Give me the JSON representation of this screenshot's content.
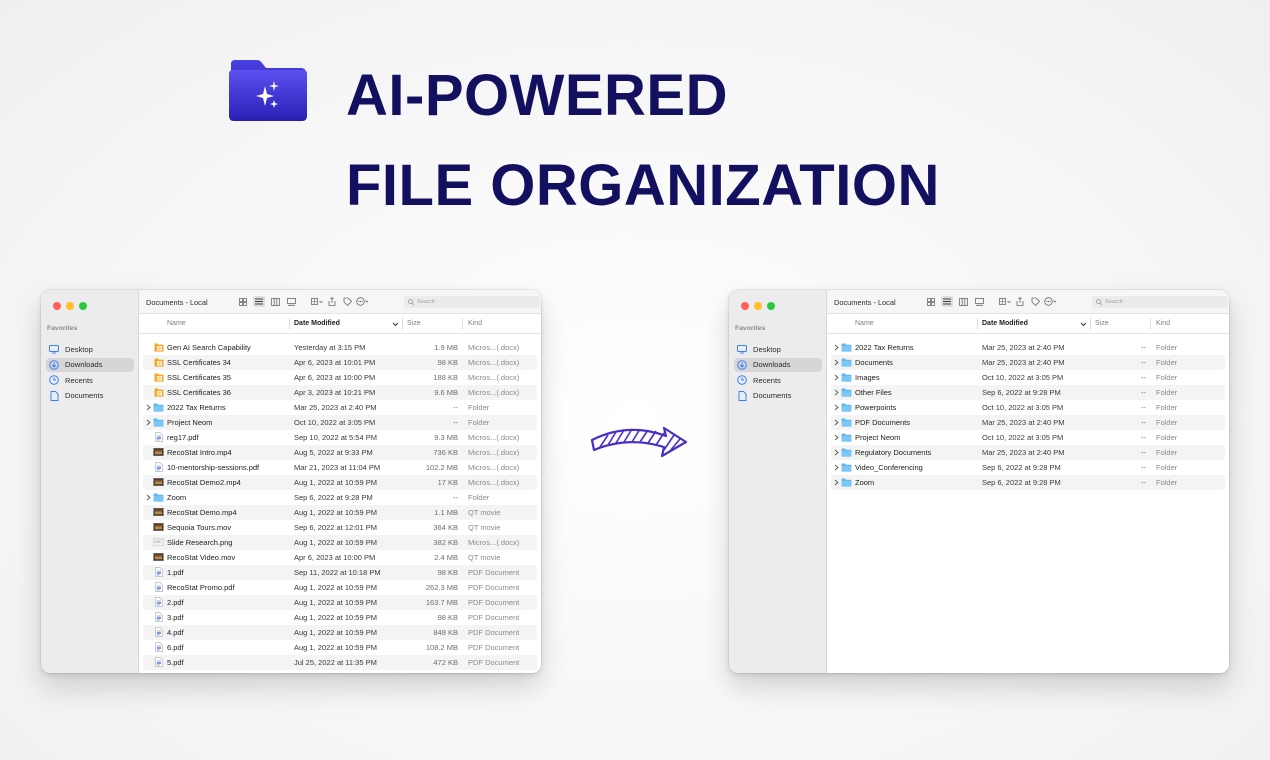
{
  "hero": {
    "line1": "AI-POWERED",
    "line2": "FILE ORGANIZATION",
    "accent_color": "#13105f",
    "icon": "folder-sparkle-icon"
  },
  "left_window": {
    "path_title": "Documents - Local",
    "search_placeholder": "Search",
    "sidebar": {
      "section": "Favorites",
      "items": [
        {
          "label": "Desktop",
          "icon": "desktop-icon",
          "selected": false
        },
        {
          "label": "Downloads",
          "icon": "download-icon",
          "selected": true
        },
        {
          "label": "Recents",
          "icon": "clock-icon",
          "selected": false
        },
        {
          "label": "Documents",
          "icon": "document-icon",
          "selected": false
        }
      ]
    },
    "columns": {
      "name": "Name",
      "date": "Date Modified",
      "size": "Size",
      "kind": "Kind"
    },
    "rows": [
      {
        "name": "Gen AI Search Capability",
        "date": "Yesterday at 3:15 PM",
        "size": "1.9 MB",
        "kind": "Micros...(.docx)",
        "icon": "docx"
      },
      {
        "name": "SSL Certificates 34",
        "date": "Apr 6, 2023 at 10:01 PM",
        "size": "98 KB",
        "kind": "Micros...(.docx)",
        "icon": "docx"
      },
      {
        "name": "SSL Certificates 35",
        "date": "Apr 6, 2023 at 10:00 PM",
        "size": "188 KB",
        "kind": "Micros...(.docx)",
        "icon": "docx"
      },
      {
        "name": "SSL Certificates 36",
        "date": "Apr 3, 2023 at 10:21 PM",
        "size": "9.6 MB",
        "kind": "Micros...(.docx)",
        "icon": "docx"
      },
      {
        "name": "2022 Tax Returns",
        "date": "Mar 25, 2023 at 2:40 PM",
        "size": "--",
        "kind": "Folder",
        "icon": "folder"
      },
      {
        "name": "Project Neom",
        "date": "Oct 10, 2022 at 3:05 PM",
        "size": "--",
        "kind": "Folder",
        "icon": "folder"
      },
      {
        "name": "reg17.pdf",
        "date": "Sep 10, 2022 at 5:54 PM",
        "size": "9.3 MB",
        "kind": "Micros...(.docx)",
        "icon": "pdf"
      },
      {
        "name": "RecoStat Intro.mp4",
        "date": "Aug 5, 2022 at 9:33 PM",
        "size": "736 KB",
        "kind": "Micros...(.docx)",
        "icon": "video"
      },
      {
        "name": "10-mentorship-sessions.pdf",
        "date": "Mar 21, 2023 at 11:04 PM",
        "size": "102.2 MB",
        "kind": "Micros...(.docx)",
        "icon": "pdf"
      },
      {
        "name": "RecoStat Demo2.mp4",
        "date": "Aug 1, 2022 at 10:59 PM",
        "size": "17 KB",
        "kind": "Micros...(.docx)",
        "icon": "video"
      },
      {
        "name": "Zoom",
        "date": "Sep 6, 2022 at 9:28 PM",
        "size": "--",
        "kind": "Folder",
        "icon": "folder"
      },
      {
        "name": "RecoStat Demo.mp4",
        "date": "Aug 1, 2022 at 10:59 PM",
        "size": "1.1 MB",
        "kind": "QT movie",
        "icon": "video"
      },
      {
        "name": "Sequoia Tours.mov",
        "date": "Sep 6, 2022 at 12:01 PM",
        "size": "364 KB",
        "kind": "QT movie",
        "icon": "video"
      },
      {
        "name": "Slide Research.png",
        "date": "Aug 1, 2022 at 10:59 PM",
        "size": "382 KB",
        "kind": "Micros...(.docx)",
        "icon": "image"
      },
      {
        "name": "RecoStat Video.mov",
        "date": "Apr 6, 2023 at 10:00 PM",
        "size": "2.4 MB",
        "kind": "QT movie",
        "icon": "video"
      },
      {
        "name": "1.pdf",
        "date": "Sep 11, 2022 at 10:18 PM",
        "size": "98 KB",
        "kind": "PDF Document",
        "icon": "pdf"
      },
      {
        "name": "RecoStat Promo.pdf",
        "date": "Aug 1, 2022 at 10:59 PM",
        "size": "262.3 MB",
        "kind": "PDF Document",
        "icon": "pdf"
      },
      {
        "name": "2.pdf",
        "date": "Aug 1, 2022 at 10:59 PM",
        "size": "163.7 MB",
        "kind": "PDF Document",
        "icon": "pdf"
      },
      {
        "name": "3.pdf",
        "date": "Aug 1, 2022 at 10:59 PM",
        "size": "98 KB",
        "kind": "PDF Document",
        "icon": "pdf"
      },
      {
        "name": "4.pdf",
        "date": "Aug 1, 2022 at 10:59 PM",
        "size": "848 KB",
        "kind": "PDF Document",
        "icon": "pdf"
      },
      {
        "name": "6.pdf",
        "date": "Aug 1, 2022 at 10:59 PM",
        "size": "108.2 MB",
        "kind": "PDF Document",
        "icon": "pdf"
      },
      {
        "name": "5.pdf",
        "date": "Jul 25, 2022 at 11:35 PM",
        "size": "472 KB",
        "kind": "PDF Document",
        "icon": "pdf"
      }
    ]
  },
  "right_window": {
    "path_title": "Documents - Local",
    "search_placeholder": "Search",
    "sidebar": {
      "section": "Favorites",
      "items": [
        {
          "label": "Desktop",
          "icon": "desktop-icon",
          "selected": false
        },
        {
          "label": "Downloads",
          "icon": "download-icon",
          "selected": true
        },
        {
          "label": "Recents",
          "icon": "clock-icon",
          "selected": false
        },
        {
          "label": "Documents",
          "icon": "document-icon",
          "selected": false
        }
      ]
    },
    "columns": {
      "name": "Name",
      "date": "Date Modified",
      "size": "Size",
      "kind": "Kind"
    },
    "rows": [
      {
        "name": "2022 Tax Returns",
        "date": "Mar 25, 2023 at 2:40 PM",
        "size": "--",
        "kind": "Folder",
        "icon": "folder"
      },
      {
        "name": "Documents",
        "date": "Mar 25, 2023 at 2:40 PM",
        "size": "--",
        "kind": "Folder",
        "icon": "folder"
      },
      {
        "name": "Images",
        "date": "Oct 10, 2022 at 3:05 PM",
        "size": "--",
        "kind": "Folder",
        "icon": "folder"
      },
      {
        "name": "Other Files",
        "date": "Sep 6, 2022 at 9:28 PM",
        "size": "--",
        "kind": "Folder",
        "icon": "folder"
      },
      {
        "name": "Powerpoints",
        "date": "Oct 10, 2022 at 3:05 PM",
        "size": "--",
        "kind": "Folder",
        "icon": "folder"
      },
      {
        "name": "PDF Documents",
        "date": "Mar 25, 2023 at 2:40 PM",
        "size": "--",
        "kind": "Folder",
        "icon": "folder"
      },
      {
        "name": "Project Neom",
        "date": "Oct 10, 2022 at 3:05 PM",
        "size": "--",
        "kind": "Folder",
        "icon": "folder"
      },
      {
        "name": "Regulatory Documents",
        "date": "Mar 25, 2023 at 2:40 PM",
        "size": "--",
        "kind": "Folder",
        "icon": "folder"
      },
      {
        "name": "Video_Conferencing",
        "date": "Sep 6, 2022 at 9:28 PM",
        "size": "--",
        "kind": "Folder",
        "icon": "folder"
      },
      {
        "name": "Zoom",
        "date": "Sep 6, 2022 at 9:28 PM",
        "size": "--",
        "kind": "Folder",
        "icon": "folder"
      }
    ]
  },
  "colors": {
    "folder_blue": "#5ab4f0",
    "docx_orange": "#f6a623",
    "selection_gray": "#d6d6d8",
    "arrow_purple": "#4a2fc4"
  }
}
